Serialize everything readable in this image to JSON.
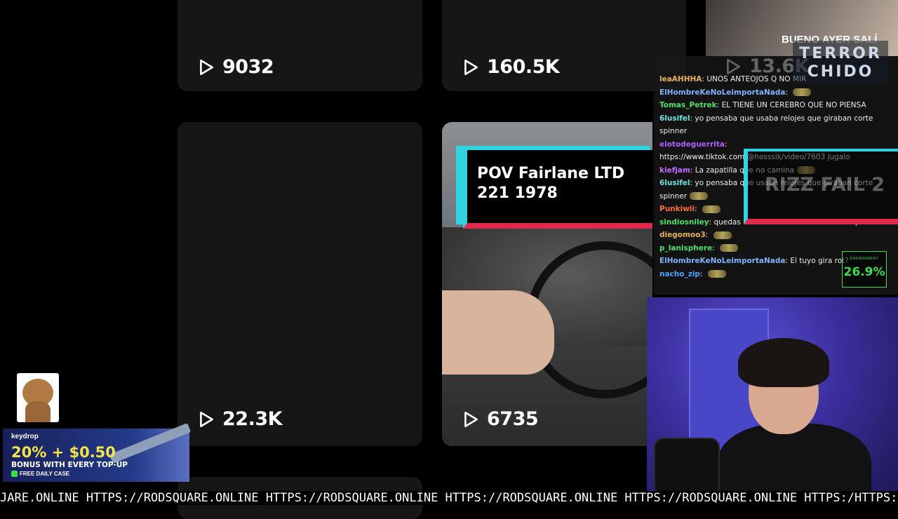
{
  "cards": {
    "top_left_views": "9032",
    "top_mid_views": "160.5K",
    "bottom_left_views": "22.3K",
    "bottom_mid_views": "6735",
    "partial_right_views": "13.6K",
    "video_title": "POV Fairlane LTD 221 1978"
  },
  "overlay": {
    "logo_line1": "TERROR",
    "logo_line2": "CHIDO",
    "top_cam_caption": "BUENO AYER SALÍ",
    "rizz_text": "RIZZ FAIL 2",
    "engagement_label": "ENGAGEMENT",
    "engagement_value": "26.9%"
  },
  "chat": {
    "messages": [
      {
        "user": "leaAHHHA",
        "color": "#e8b15a",
        "text": "UNOS ANTEOJOS Q NO MIR",
        "emote": false
      },
      {
        "user": "ElHombreKeNoLeimportaNada",
        "color": "#7fb2ff",
        "text": "",
        "emote": true
      },
      {
        "user": "Tomas_Petrek",
        "color": "#4ee06b",
        "text": "EL TIENE UN CEREBRO QUE NO PIENSA",
        "emote": false
      },
      {
        "user": "6lusifel",
        "color": "#6fe0e0",
        "text": "yo pensaba que usaba relojes que giraban corte spinner",
        "emote": false
      },
      {
        "user": "elotodeguerrita",
        "color": "#b05cff",
        "text": "https://www.tiktok.com/@hosssik/video/7603 jugalo",
        "emote": false
      },
      {
        "user": "kiefjam",
        "color": "#c26bff",
        "text": "La zapatilla que no camina",
        "emote": true
      },
      {
        "user": "6lusifel",
        "color": "#6fe0e0",
        "text": "yo pensaba que usaba relojes que giraban corte spinner",
        "emote": true
      },
      {
        "user": "Punkiwii",
        "color": "#ff6b3d",
        "text": "",
        "emote": true
      },
      {
        "user": "sindiosniley",
        "color": "#4ee06b",
        "text": "quedas mas bobo mirandola en el reloj",
        "emote": false
      },
      {
        "user": "diegomoo3",
        "color": "#e8b15a",
        "text": "",
        "emote": true
      },
      {
        "user": "p_lanisphere",
        "color": "#4ee06b",
        "text": "",
        "emote": true
      },
      {
        "user": "ElHombreKeNoLeimportaNada",
        "color": "#7fb2ff",
        "text": "El tuyo gira rot?",
        "emote": false
      },
      {
        "user": "nacho_zip",
        "color": "#4aa3ff",
        "text": "",
        "emote": true
      }
    ]
  },
  "ad": {
    "brand": "keydrop",
    "promo": "20% + $0.50",
    "sub": "BONUS WITH EVERY TOP-UP",
    "free": "FREE DAILY CASE"
  },
  "ticker": {
    "text": "JARE.ONLINE HTTPS://RODSQUARE.ONLINE HTTPS://RODSQUARE.ONLINE HTTPS://RODSQUARE.ONLINE HTTPS://RODSQUARE.ONLINE HTTPS:/HTTPS://RODSQ"
  },
  "icons": {
    "play": "play-triangle-icon"
  }
}
